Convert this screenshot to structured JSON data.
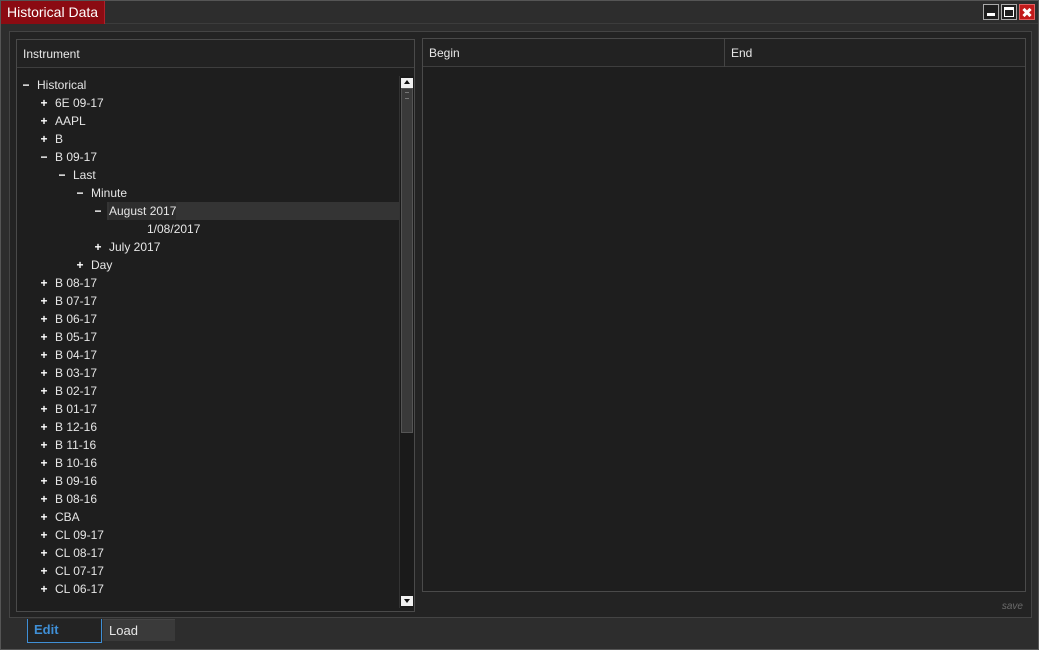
{
  "window": {
    "title": "Historical Data",
    "controls": [
      "minimize-icon",
      "maximize-icon",
      "close-icon"
    ],
    "accent_color": "#8b0b12"
  },
  "left_panel": {
    "header": "Instrument",
    "tree": [
      {
        "label": "Historical",
        "toggle": "−",
        "depth": 0
      },
      {
        "label": "6E 09-17",
        "toggle": "+",
        "depth": 1
      },
      {
        "label": "AAPL",
        "toggle": "+",
        "depth": 1
      },
      {
        "label": "B",
        "toggle": "+",
        "depth": 1
      },
      {
        "label": "B 09-17",
        "toggle": "−",
        "depth": 1
      },
      {
        "label": "Last",
        "toggle": "−",
        "depth": 2
      },
      {
        "label": "Minute",
        "toggle": "−",
        "depth": 3
      },
      {
        "label": "August 2017",
        "toggle": "−",
        "depth": 4,
        "selected": true
      },
      {
        "label": "1/08/2017",
        "toggle": "",
        "depth": 5
      },
      {
        "label": "July 2017",
        "toggle": "+",
        "depth": 4
      },
      {
        "label": "Day",
        "toggle": "+",
        "depth": 3
      },
      {
        "label": "B 08-17",
        "toggle": "+",
        "depth": 1
      },
      {
        "label": "B 07-17",
        "toggle": "+",
        "depth": 1
      },
      {
        "label": "B 06-17",
        "toggle": "+",
        "depth": 1
      },
      {
        "label": "B 05-17",
        "toggle": "+",
        "depth": 1
      },
      {
        "label": "B 04-17",
        "toggle": "+",
        "depth": 1
      },
      {
        "label": "B 03-17",
        "toggle": "+",
        "depth": 1
      },
      {
        "label": "B 02-17",
        "toggle": "+",
        "depth": 1
      },
      {
        "label": "B 01-17",
        "toggle": "+",
        "depth": 1
      },
      {
        "label": "B 12-16",
        "toggle": "+",
        "depth": 1
      },
      {
        "label": "B 11-16",
        "toggle": "+",
        "depth": 1
      },
      {
        "label": "B 10-16",
        "toggle": "+",
        "depth": 1
      },
      {
        "label": "B 09-16",
        "toggle": "+",
        "depth": 1
      },
      {
        "label": "B 08-16",
        "toggle": "+",
        "depth": 1
      },
      {
        "label": "CBA",
        "toggle": "+",
        "depth": 1
      },
      {
        "label": "CL 09-17",
        "toggle": "+",
        "depth": 1
      },
      {
        "label": "CL 08-17",
        "toggle": "+",
        "depth": 1
      },
      {
        "label": "CL 07-17",
        "toggle": "+",
        "depth": 1
      },
      {
        "label": "CL 06-17",
        "toggle": "+",
        "depth": 1
      }
    ]
  },
  "right_panel": {
    "columns": [
      "Begin",
      "End"
    ],
    "save_label": "save"
  },
  "tabs": [
    {
      "label": "Edit",
      "active": true
    },
    {
      "label": "Load",
      "active": false
    }
  ],
  "colors": {
    "active_tab": "#3f8fd6",
    "background": "#1e1e1e"
  }
}
